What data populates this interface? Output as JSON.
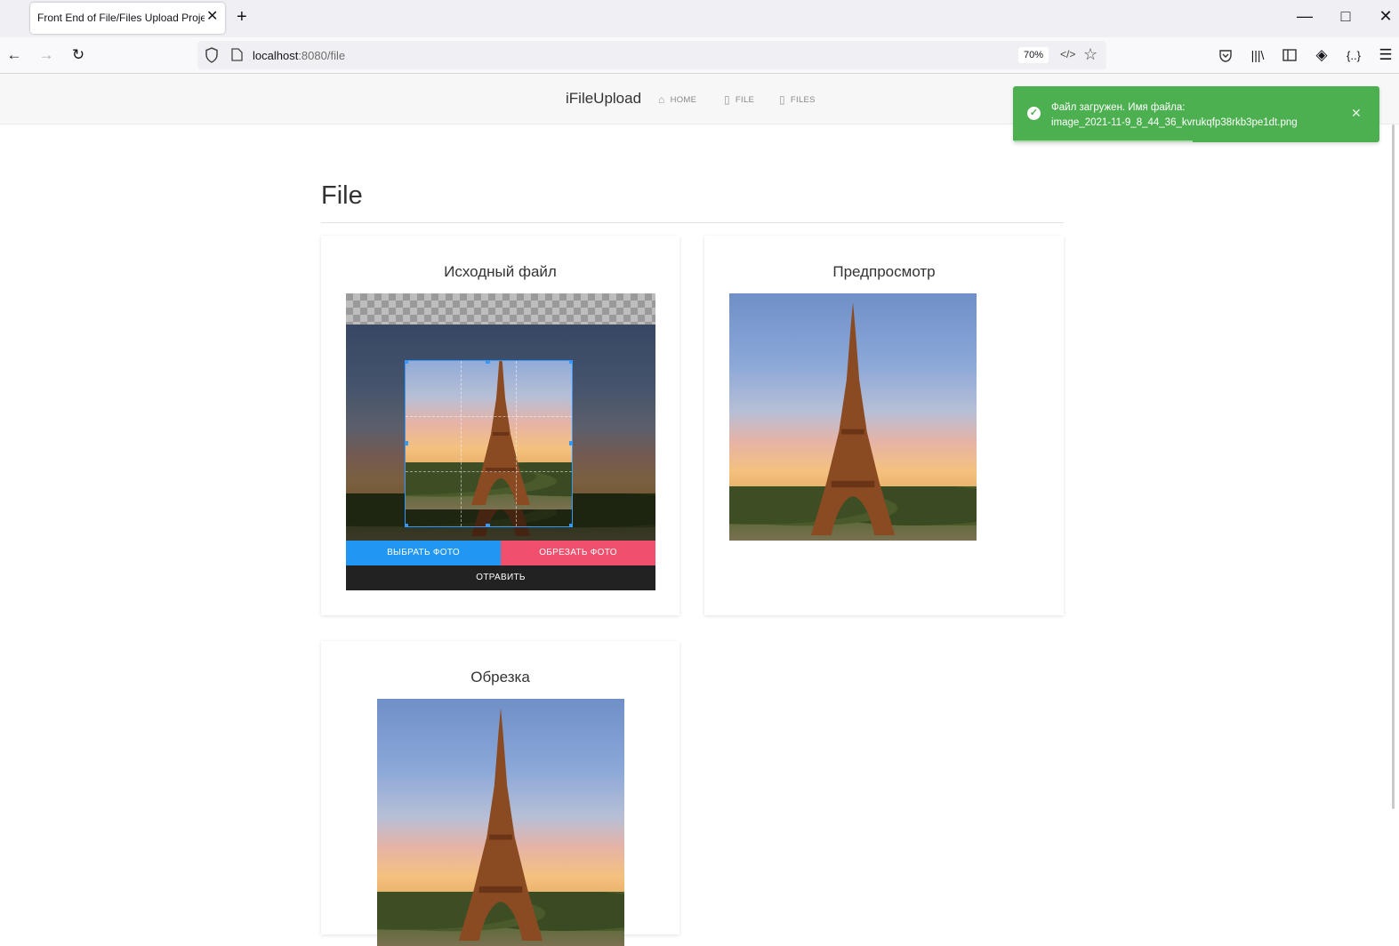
{
  "browser": {
    "tab_title": "Front End of File/Files Upload Project",
    "url_host": "localhost",
    "url_path": ":8080/file",
    "zoom": "70%"
  },
  "app": {
    "brand": "iFileUpload",
    "nav": [
      {
        "label": "HOME",
        "icon": "home-icon"
      },
      {
        "label": "FILE",
        "icon": "file-icon"
      },
      {
        "label": "FILES",
        "icon": "files-icon"
      }
    ]
  },
  "toast": {
    "line1": "Файл загружен. Имя файла:",
    "line2": "image_2021-11-9_8_44_36_kvrukqfp38rkb3pe1dt.png",
    "progress": 0.49,
    "color": "#4caf50"
  },
  "page": {
    "title": "File",
    "source_card": {
      "title": "Исходный файл",
      "choose_label": "ВЫБРАТЬ ФОТО",
      "crop_label": "ОБРЕЗАТЬ ФОТО",
      "send_label": "ОТРАВИТЬ"
    },
    "preview_card": {
      "title": "Предпросмотр"
    },
    "crop_card": {
      "title": "Обрезка"
    }
  },
  "colors": {
    "choose_button": "#2196f3",
    "crop_button": "#f0506e",
    "send_button": "#222222",
    "crop_outline": "#3399ff"
  }
}
